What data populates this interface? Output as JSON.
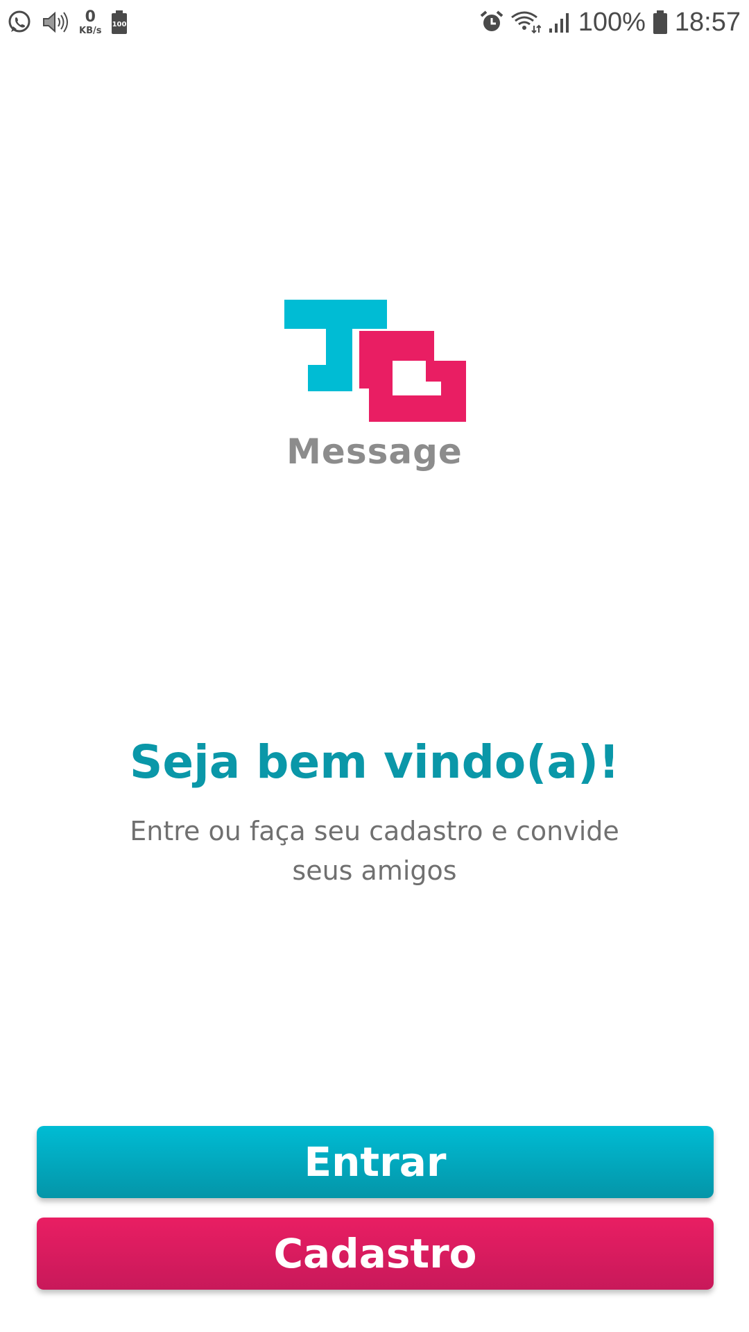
{
  "status_bar": {
    "left_icons": [
      "whatsapp-icon",
      "speaker-icon",
      "data-speed-icon",
      "battery-saver-icon"
    ],
    "data_speed_value": "0",
    "data_speed_unit": "KB/s",
    "battery_saver_label": "100",
    "right_icons": [
      "alarm-icon",
      "wifi-icon",
      "signal-icon",
      "battery-icon"
    ],
    "battery_percent": "100%",
    "time": "18:57"
  },
  "logo": {
    "caption": "Message",
    "colors": {
      "teal": "#00bcd4",
      "pink": "#e91e63"
    }
  },
  "welcome": {
    "title": "Seja bem vindo(a)!",
    "subtitle": "Entre ou faça seu cadastro e convide seus amigos"
  },
  "actions": {
    "enter_label": "Entrar",
    "register_label": "Cadastro"
  },
  "colors": {
    "title": "#0a97a8",
    "enter_button": "#00bcd4",
    "register_button": "#e91e63"
  }
}
